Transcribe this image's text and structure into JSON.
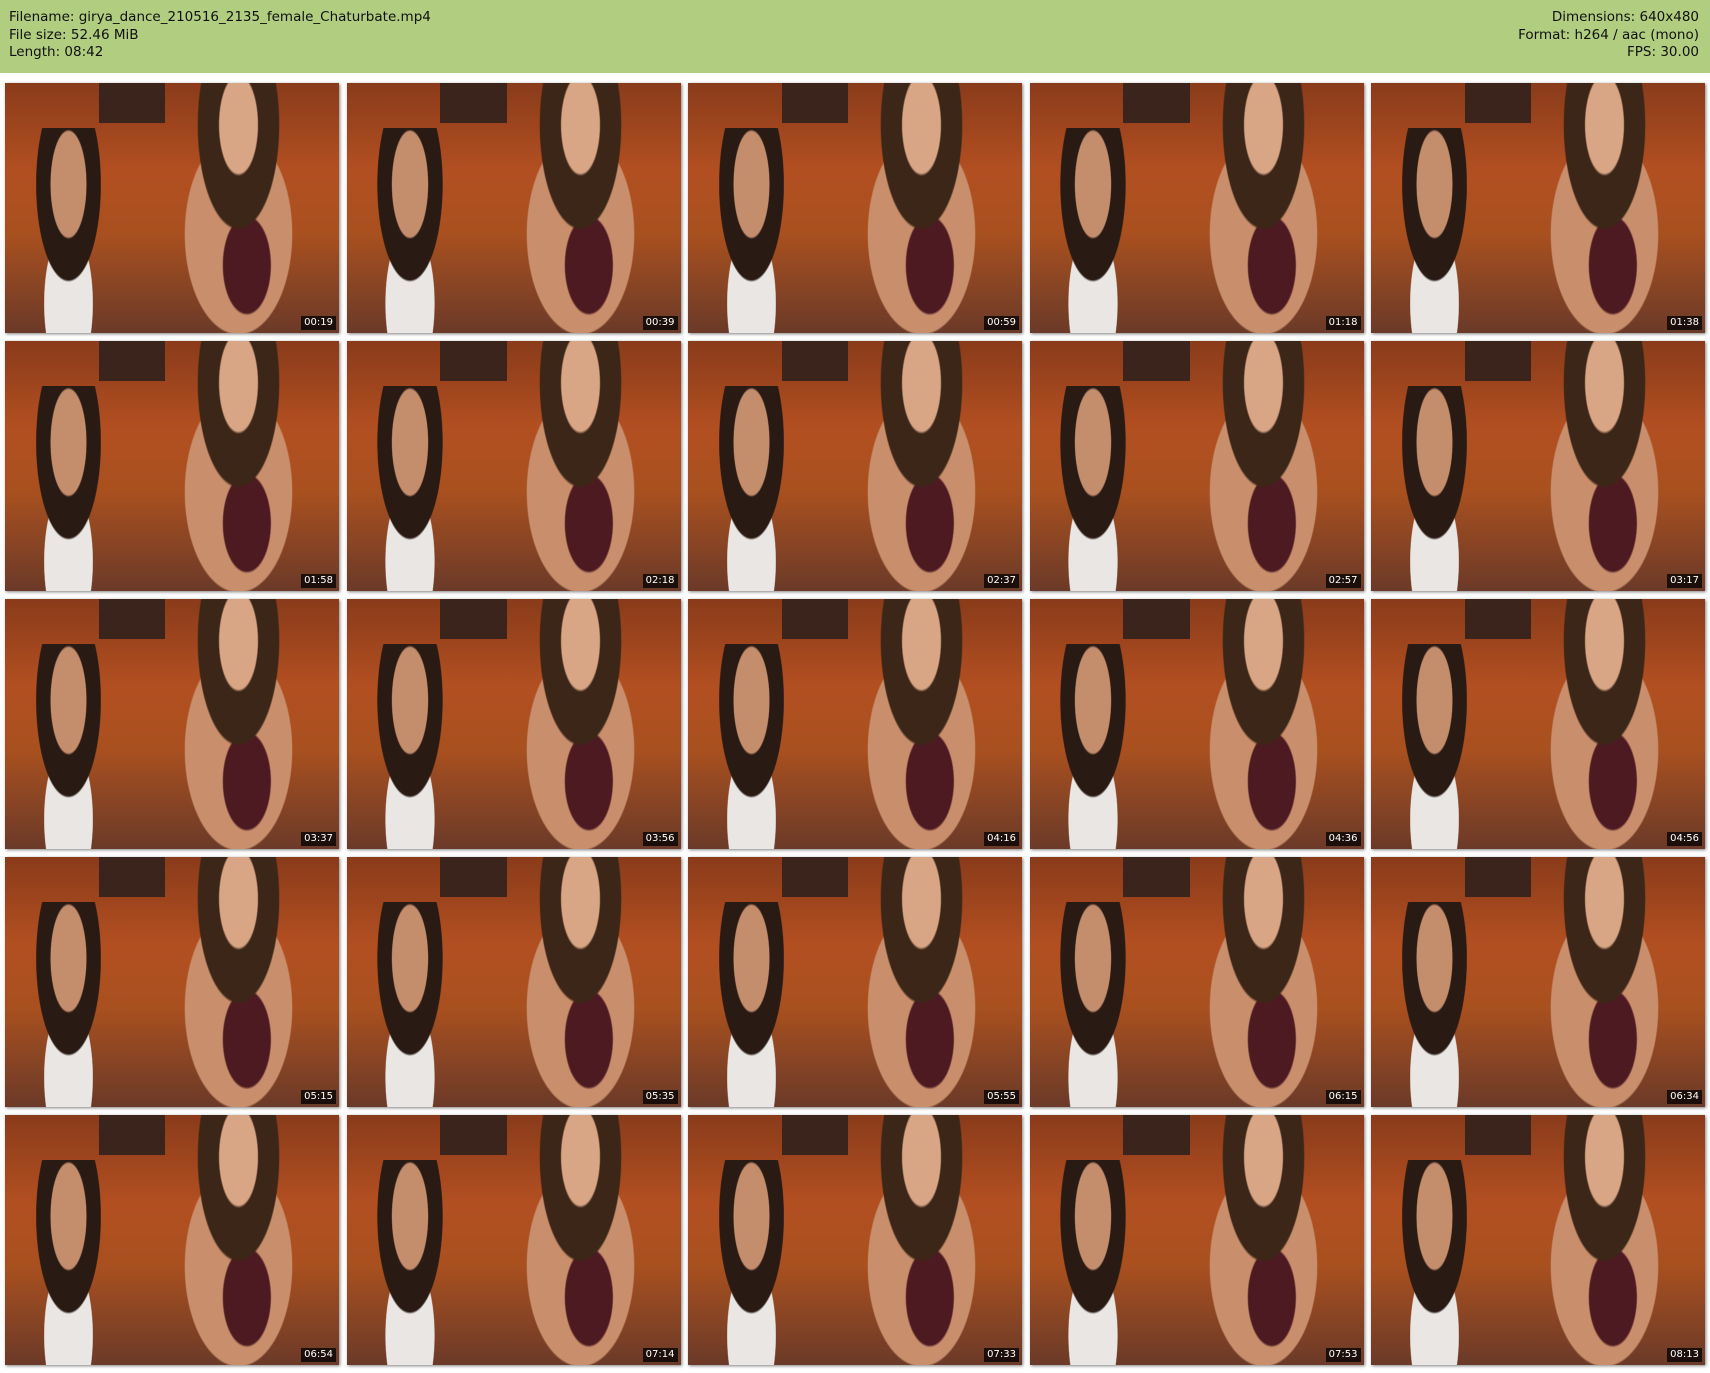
{
  "header": {
    "filename": "Filename: girya_dance_210516_2135_female_Chaturbate.mp4",
    "filesize": "File size: 52.46 MiB",
    "length": "Length: 08:42",
    "dimensions": "Dimensions: 640x480",
    "format": "Format: h264 / aac (mono)",
    "fps": "FPS: 30.00"
  },
  "thumbnails": [
    "00:19",
    "00:39",
    "00:59",
    "01:18",
    "01:38",
    "01:58",
    "02:18",
    "02:37",
    "02:57",
    "03:17",
    "03:37",
    "03:56",
    "04:16",
    "04:36",
    "04:56",
    "05:15",
    "05:35",
    "05:55",
    "06:15",
    "06:34",
    "06:54",
    "07:14",
    "07:33",
    "07:53",
    "08:13"
  ]
}
